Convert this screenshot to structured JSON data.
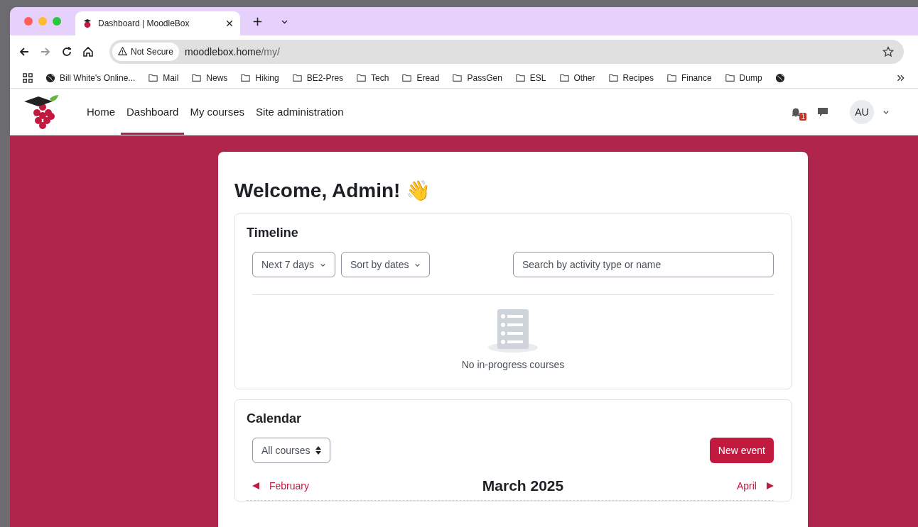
{
  "browser": {
    "tabs": [
      {
        "title": "Dashboard | MoodleBox",
        "selected": true
      }
    ],
    "security": "Not Secure",
    "url_host": "moodlebox.home",
    "url_path": "/my/",
    "bookmarks": [
      {
        "label": "Bill White's Online...",
        "kind": "globe"
      },
      {
        "label": "Mail",
        "kind": "folder"
      },
      {
        "label": "News",
        "kind": "folder"
      },
      {
        "label": "Hiking",
        "kind": "folder"
      },
      {
        "label": "BE2-Pres",
        "kind": "folder"
      },
      {
        "label": "Tech",
        "kind": "folder"
      },
      {
        "label": "Eread",
        "kind": "folder"
      },
      {
        "label": "PassGen",
        "kind": "folder"
      },
      {
        "label": "ESL",
        "kind": "folder"
      },
      {
        "label": "Other",
        "kind": "folder"
      },
      {
        "label": "Recipes",
        "kind": "folder"
      },
      {
        "label": "Finance",
        "kind": "folder"
      },
      {
        "label": "Dump",
        "kind": "folder"
      },
      {
        "kind": "globe"
      }
    ]
  },
  "nav": {
    "items": [
      {
        "label": "Home",
        "selected": false
      },
      {
        "label": "Dashboard",
        "selected": true
      },
      {
        "label": "My courses",
        "selected": false
      },
      {
        "label": "Site administration",
        "selected": false
      }
    ],
    "notification_count": "1",
    "avatar": "AU"
  },
  "page": {
    "title": "Welcome, Admin! 👋",
    "timeline": {
      "title": "Timeline",
      "filters": [
        "Next 7 days",
        "Sort by dates"
      ],
      "search": {
        "placeholder": "Search by activity type or name"
      },
      "empty_message": "No in-progress courses"
    },
    "calendar": {
      "title": "Calendar",
      "course_select": "All courses",
      "new_event": "New event",
      "prev": "February",
      "month": "March 2025",
      "next": "April"
    }
  }
}
